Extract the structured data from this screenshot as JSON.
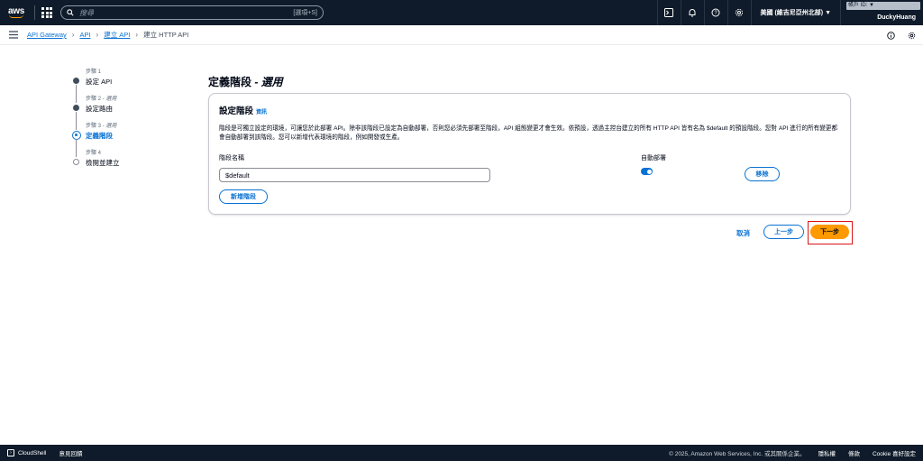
{
  "topnav": {
    "logo_text": "aws",
    "search_placeholder": "搜尋",
    "search_hint": "[選項+S]",
    "region": "美國 (維吉尼亞州北部) ▼",
    "account_label": "帳戶 ID: ▼",
    "username": "DuckyHuang"
  },
  "breadcrumb": {
    "items": [
      "API Gateway",
      "API",
      "建立 API"
    ],
    "current": "建立 HTTP API"
  },
  "steps": [
    {
      "label": "步驟 1",
      "opt": "",
      "name": "設定 API"
    },
    {
      "label": "步驟 2 - ",
      "opt": "選用",
      "name": "設定路由"
    },
    {
      "label": "步驟 3 - ",
      "opt": "選用",
      "name": "定義階段"
    },
    {
      "label": "步驟 4",
      "opt": "",
      "name": "檢閱並建立"
    }
  ],
  "page": {
    "title": "定義階段 - ",
    "title_opt": "選用"
  },
  "panel": {
    "title": "設定階段",
    "info": "資訊",
    "description": "階段是可獨立設定的環境，可讓您於此部署 API。除非該階段已設定為自動部署，否則您必須先部署至階段，API 組態變更才會生效。依預設，透過主控台建立的所有 HTTP API 皆有名為 $default 的預設階段。您對 API 進行的所有變更都會自動部署到該階段。您可以新增代表環境的階段，例如開發或生產。",
    "stage_name_label": "階段名稱",
    "stage_name_value": "$default",
    "auto_deploy_label": "自動部署",
    "auto_deploy_on": true,
    "remove_button": "移除",
    "add_stage_button": "新增階段"
  },
  "actions": {
    "cancel": "取消",
    "previous": "上一步",
    "next": "下一步"
  },
  "footer": {
    "cloudshell": "CloudShell",
    "feedback": "意見回饋",
    "copyright": "© 2025, Amazon Web Services, Inc. 或其關係企業。",
    "privacy": "隱私權",
    "terms": "條款",
    "cookie": "Cookie 喜好設定"
  },
  "colors": {
    "nav_bg": "#0f1b2a",
    "link": "#0972d3",
    "primary": "#ff9900",
    "highlight": "#d91515"
  }
}
